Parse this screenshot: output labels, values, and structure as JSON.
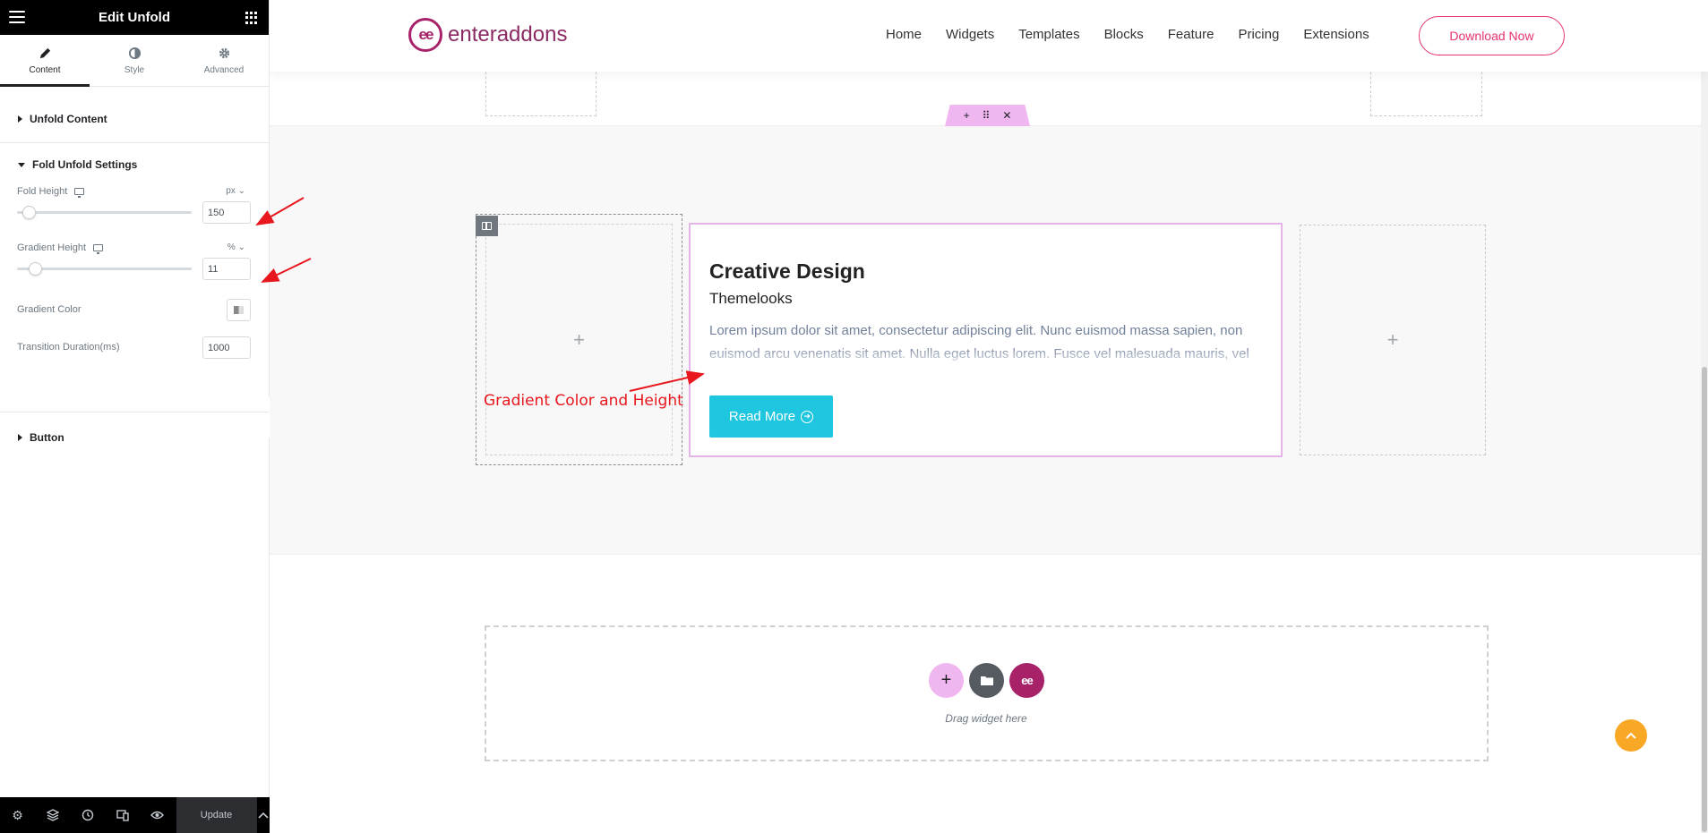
{
  "panel": {
    "title": "Edit Unfold",
    "tabs": [
      {
        "label": "Content",
        "icon": "pencil-icon"
      },
      {
        "label": "Style",
        "icon": "half-circle-icon"
      },
      {
        "label": "Advanced",
        "icon": "gear-icon"
      }
    ],
    "sections": {
      "unfold_content": "Unfold Content",
      "fold_settings": "Fold Unfold Settings",
      "button": "Button"
    },
    "controls": {
      "fold_height": {
        "label": "Fold Height",
        "unit": "px",
        "value": "150",
        "slider_fraction": 0.05
      },
      "gradient_height": {
        "label": "Gradient Height",
        "unit": "%",
        "value": "11",
        "slider_fraction": 0.11
      },
      "gradient_color": {
        "label": "Gradient Color"
      },
      "transition_duration": {
        "label": "Transition Duration(ms)",
        "value": "1000"
      }
    },
    "footer": {
      "update_label": "Update",
      "icons": [
        "gear-icon",
        "layers-icon",
        "history-icon",
        "responsive-icon",
        "eye-icon",
        "chevron-up-icon"
      ]
    }
  },
  "site": {
    "logo_text": "enteraddons",
    "menu": [
      "Home",
      "Widgets",
      "Templates",
      "Blocks",
      "Feature",
      "Pricing",
      "Extensions"
    ],
    "cta": "Download Now",
    "accent_color": "#e5336f"
  },
  "card": {
    "title": "Creative Design",
    "subtitle": "Themelooks",
    "body": "Lorem ipsum dolor sit amet, consectetur adipiscing elit. Nunc euismod massa sapien, non euismod arcu venenatis sit amet. Nulla eget luctus lorem. Fusce vel malesuada mauris, vel bibendum tellus. Quisque quis sapien sent urna vestibulum blandit. Sed eu",
    "button": "Read More",
    "button_color": "#1ec6e0"
  },
  "annotation": {
    "text": "Gradient Color and Height",
    "color": "#e8171d"
  },
  "dropzone": {
    "text": "Drag widget here"
  },
  "placeholders": {
    "plus": "+"
  }
}
